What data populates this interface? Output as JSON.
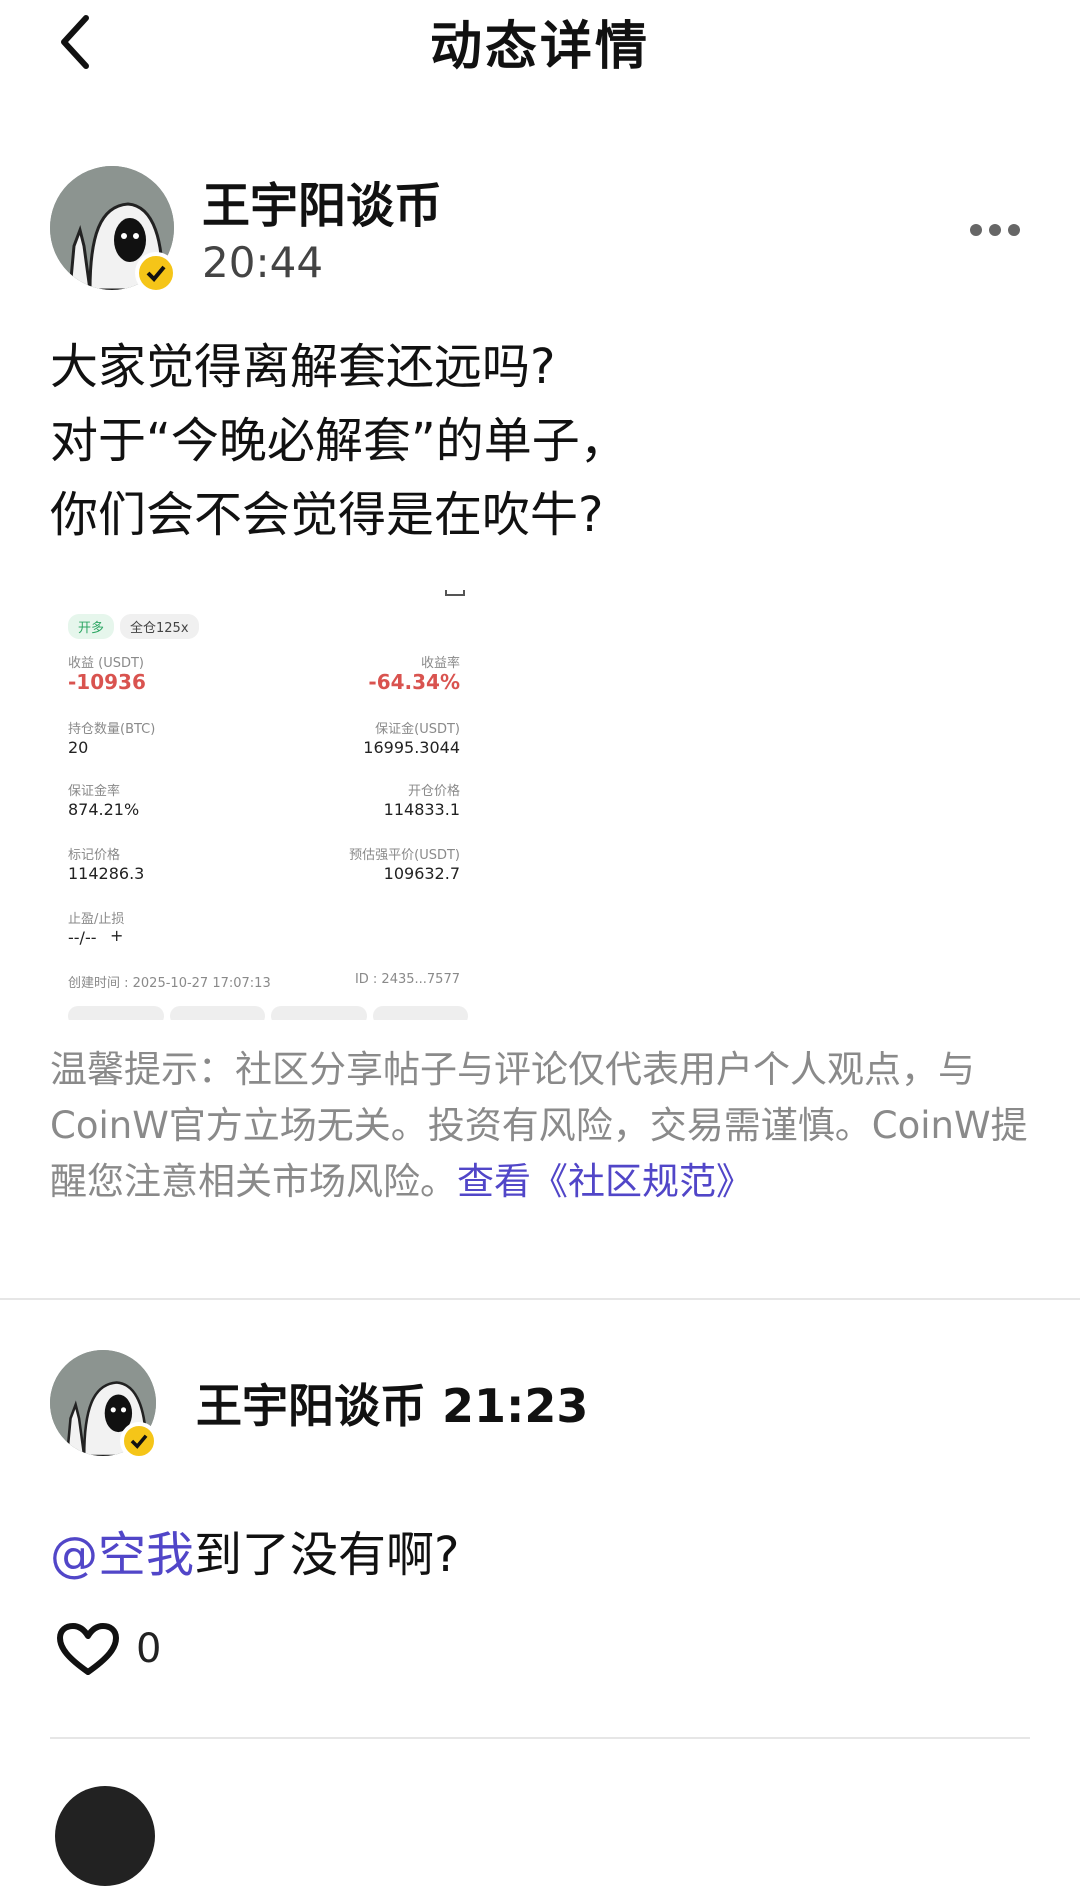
{
  "header": {
    "title": "动态详情"
  },
  "post": {
    "author": "王宇阳谈币",
    "time": "20:44",
    "lines": [
      "大家觉得离解套还远吗?",
      "对于“今晚必解套”的单子，",
      "你们会不会觉得是在吹牛?"
    ]
  },
  "position_card": {
    "tag_side": "开多",
    "tag_leverage": "全仓125x",
    "pnl_label": "收益 (USDT)",
    "pnl_value": "-10936",
    "roi_label": "收益率",
    "roi_value": "-64.34%",
    "size_label": "持仓数量(BTC)",
    "size_value": "20",
    "margin_label": "保证金(USDT)",
    "margin_value": "16995.3044",
    "margin_rate_label": "保证金率",
    "margin_rate_value": "874.21%",
    "open_price_label": "开仓价格",
    "open_price_value": "114833.1",
    "mark_price_label": "标记价格",
    "mark_price_value": "114286.3",
    "liq_price_label": "预估强平价(USDT)",
    "liq_price_value": "109632.7",
    "tpsl_label": "止盈/止损",
    "tpsl_value": "--/--",
    "tpsl_add": "+",
    "created": "创建时间 : 2025-10-27 17:07:13",
    "id": "ID : 2435...7577"
  },
  "disclaimer": {
    "text": "温馨提示：社区分享帖子与评论仅代表用户个人观点，与CoinW官方立场无关。投资有风险，交易需谨慎。CoinW提醒您注意相关市场风险。",
    "link": "查看《社区规范》"
  },
  "comment": {
    "author_time": "王宇阳谈币 21:23",
    "mention": "@空我",
    "text": "到了没有啊?",
    "likes": "0"
  },
  "icons": {
    "back": "chevron-left-icon",
    "more": "more-dots-icon",
    "like": "heart-icon",
    "verified": "verified-check-icon"
  },
  "colors": {
    "link": "#5146c8",
    "loss": "#d9534f",
    "verified": "#f5c518"
  }
}
